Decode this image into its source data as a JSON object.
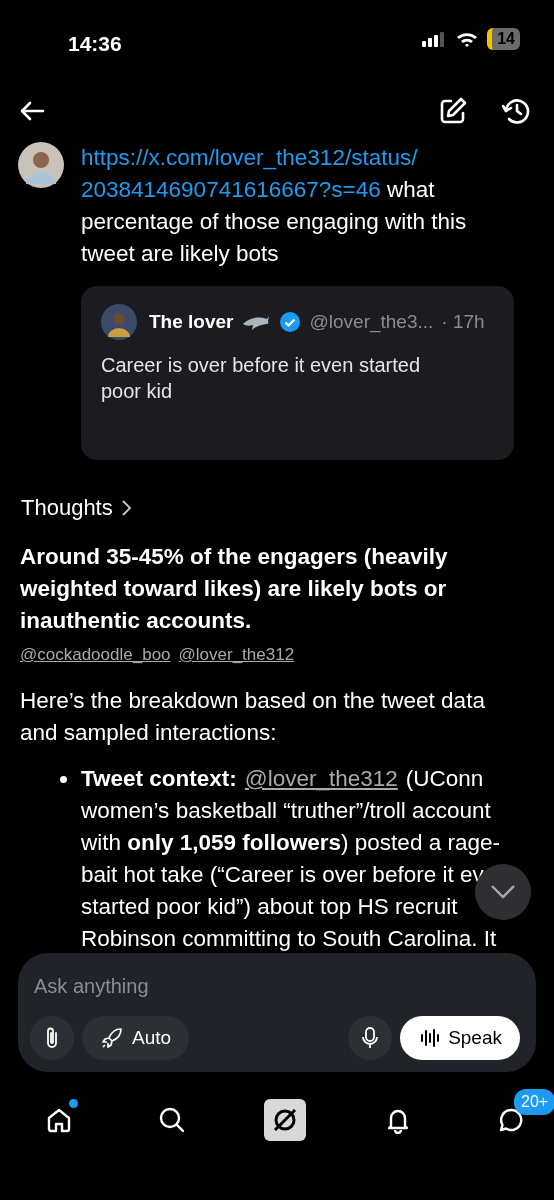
{
  "status_bar": {
    "time": "14:36",
    "battery": "14"
  },
  "user_message": {
    "link_lines": [
      "https://x.com/lover_the312/status/",
      "2038414690741616667?s=46"
    ],
    "text": "what percentage of those engaging with this tweet are likely bots"
  },
  "quoted_tweet": {
    "name": "The lover",
    "verified": true,
    "handle": "@lover_the3...",
    "time": "· 17h",
    "text": "Career is over before it even started poor kid"
  },
  "thoughts": {
    "label": "Thoughts"
  },
  "answer": {
    "headline": "Around 35-45% of the engagers (heavily weighted toward likes) are likely bots or inauthentic accounts.",
    "mentions": [
      "@cockadoodle_boo",
      "@lover_the312"
    ],
    "intro": "Here’s the breakdown based on the tweet data and sampled interactions:",
    "bullets": [
      {
        "label": "Tweet context:",
        "mention": "@lover_the312",
        "lines": [
          "(UConn",
          "women’s basketball “truther”/troll account",
          "with **only 1,059 followers**) posted a rage-",
          "bait hot take (“Career is over before it ev",
          "started poor kid”) about top HS recruit",
          "Robinson committing to South Carolina. It"
        ]
      }
    ]
  },
  "composer": {
    "placeholder": "Ask anything",
    "mode": "Auto",
    "speak": "Speak"
  },
  "tab_bar": [
    {
      "kind": "home",
      "selected": false,
      "dot": true
    },
    {
      "kind": "search",
      "selected": false,
      "dot": false
    },
    {
      "kind": "grok",
      "selected": true,
      "dot": false
    },
    {
      "kind": "bell",
      "selected": false,
      "dot": false
    },
    {
      "kind": "messages",
      "selected": false,
      "dot": false,
      "badge": "20+"
    }
  ]
}
